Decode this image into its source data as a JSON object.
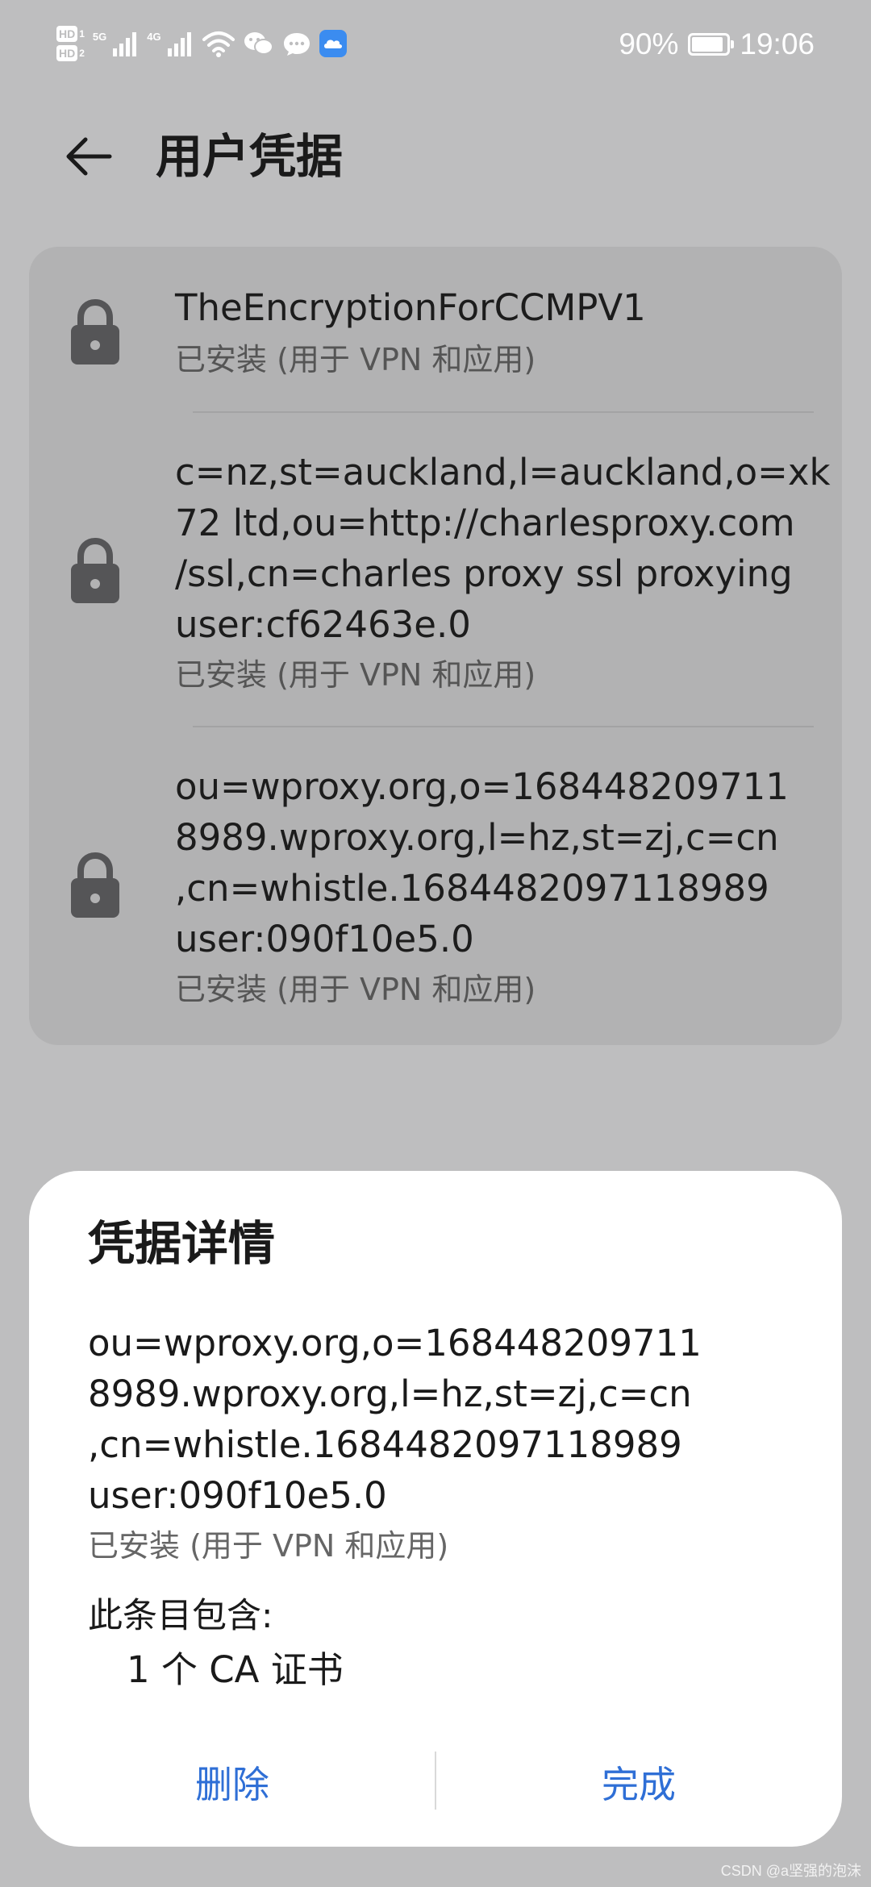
{
  "status_bar": {
    "hd1": "HD",
    "hd1_num": "1",
    "hd2": "HD",
    "hd2_num": "2",
    "net1": "5G",
    "net2": "4G",
    "wifi_num": "6",
    "battery_percent": "90%",
    "battery_level": 0.9,
    "time": "19:06",
    "icons": [
      "signal-icon",
      "wifi-icon",
      "wechat-icon",
      "chat-icon",
      "cloud-icon",
      "battery-icon"
    ]
  },
  "header": {
    "title": "用户凭据",
    "back_icon": "back-arrow-icon"
  },
  "credentials": [
    {
      "name": "TheEncryptionForCCMPV1",
      "status": "已安装 (用于 VPN 和应用)",
      "icon": "lock-icon"
    },
    {
      "name": "c=nz,st=auckland,l=auckland,o=xk\n72 ltd,ou=http://charlesproxy.com\n/ssl,cn=charles proxy ssl proxying\nuser:cf62463e.0",
      "status": "已安装 (用于 VPN 和应用)",
      "icon": "lock-icon"
    },
    {
      "name": "ou=wproxy.org,o=168448209711\n8989.wproxy.org,l=hz,st=zj,c=cn\n,cn=whistle.1684482097118989\nuser:090f10e5.0",
      "status": "已安装 (用于 VPN 和应用)",
      "icon": "lock-icon"
    }
  ],
  "dialog": {
    "title": "凭据详情",
    "name": "ou=wproxy.org,o=168448209711\n8989.wproxy.org,l=hz,st=zj,c=cn\n,cn=whistle.1684482097118989\nuser:090f10e5.0",
    "status": "已安装 (用于 VPN 和应用)",
    "contains_label": "此条目包含:",
    "contains_value": "1 个 CA 证书",
    "delete_label": "删除",
    "done_label": "完成",
    "accent_color": "#2f6fd6"
  },
  "watermark": "CSDN @a坚强的泡沫"
}
